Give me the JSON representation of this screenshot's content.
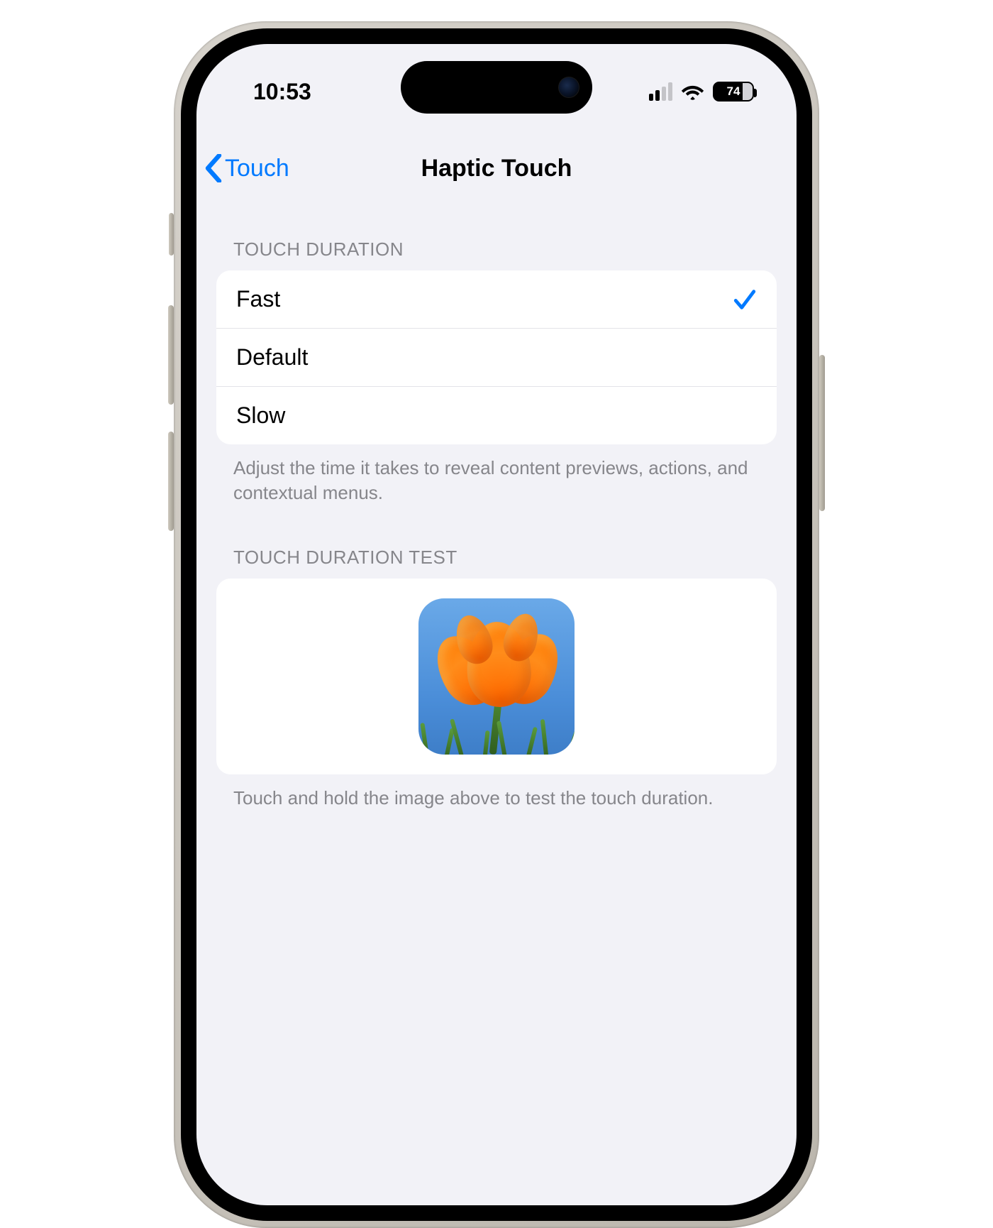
{
  "status": {
    "time": "10:53",
    "battery": "74"
  },
  "nav": {
    "back_label": "Touch",
    "title": "Haptic Touch"
  },
  "section1": {
    "header": "TOUCH DURATION",
    "options": {
      "fast": "Fast",
      "default": "Default",
      "slow": "Slow"
    },
    "selected": "fast",
    "footer": "Adjust the time it takes to reveal content previews, actions, and contextual menus."
  },
  "section2": {
    "header": "TOUCH DURATION TEST",
    "footer": "Touch and hold the image above to test the touch duration."
  }
}
